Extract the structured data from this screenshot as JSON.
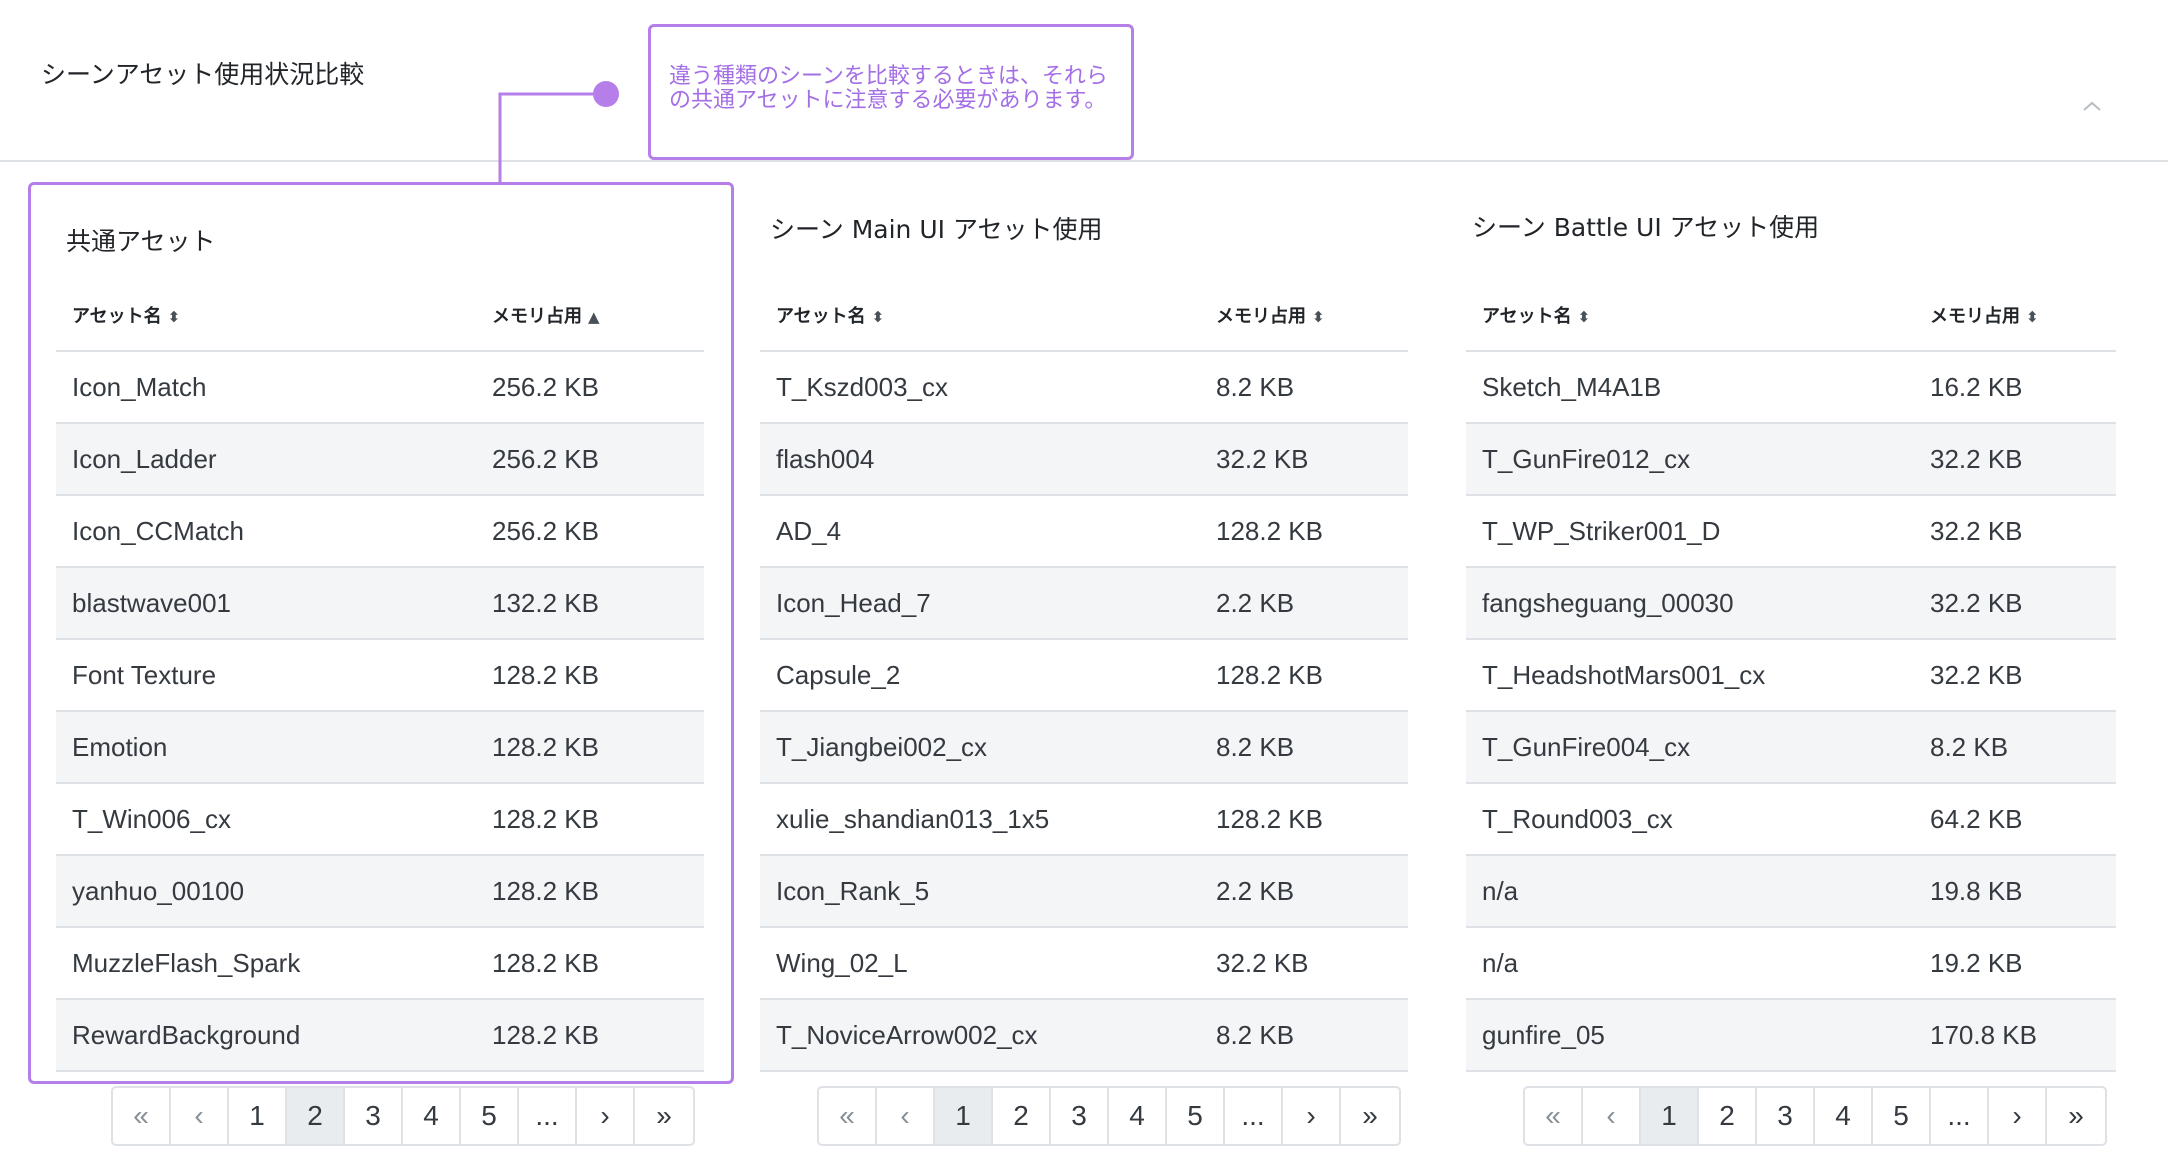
{
  "page_title": "シーンアセット使用状況比較",
  "callout": {
    "text": "違う種類のシーンを比較するときは、それらの共通アセットに注意する必要があります。"
  },
  "colors": {
    "accent": "#b57ee8",
    "stripe": "#f4f5f7",
    "border": "#dee2e6"
  },
  "icons": {
    "collapse": "chevron-up-icon",
    "sort": "sort-icon",
    "sort_asc": "sort-asc-icon"
  },
  "panels": [
    {
      "title": "共通アセット",
      "columns": [
        {
          "label": "アセット名",
          "sort": "both"
        },
        {
          "label": "メモリ占用",
          "sort": "asc"
        }
      ],
      "rows": [
        [
          "Icon_Match",
          "256.2 KB"
        ],
        [
          "Icon_Ladder",
          "256.2 KB"
        ],
        [
          "Icon_CCMatch",
          "256.2 KB"
        ],
        [
          "blastwave001",
          "132.2 KB"
        ],
        [
          "Font Texture",
          "128.2 KB"
        ],
        [
          "Emotion",
          "128.2 KB"
        ],
        [
          "T_Win006_cx",
          "128.2 KB"
        ],
        [
          "yanhuo_00100",
          "128.2 KB"
        ],
        [
          "MuzzleFlash_Spark",
          "128.2 KB"
        ],
        [
          "RewardBackground",
          "128.2 KB"
        ]
      ],
      "pagination": {
        "first": "«",
        "prev": "‹",
        "pages": [
          "1",
          "2",
          "3",
          "4",
          "5"
        ],
        "ellipsis": "...",
        "next": "›",
        "last": "»",
        "active": "2"
      }
    },
    {
      "title": "シーン Main UI アセット使用",
      "columns": [
        {
          "label": "アセット名",
          "sort": "both"
        },
        {
          "label": "メモリ占用",
          "sort": "both"
        }
      ],
      "rows": [
        [
          "T_Kszd003_cx",
          "8.2 KB"
        ],
        [
          "flash004",
          "32.2 KB"
        ],
        [
          "AD_4",
          "128.2 KB"
        ],
        [
          "Icon_Head_7",
          "2.2 KB"
        ],
        [
          "Capsule_2",
          "128.2 KB"
        ],
        [
          "T_Jiangbei002_cx",
          "8.2 KB"
        ],
        [
          "xulie_shandian013_1x5",
          "128.2 KB"
        ],
        [
          "Icon_Rank_5",
          "2.2 KB"
        ],
        [
          "Wing_02_L",
          "32.2 KB"
        ],
        [
          "T_NoviceArrow002_cx",
          "8.2 KB"
        ]
      ],
      "pagination": {
        "first": "«",
        "prev": "‹",
        "pages": [
          "1",
          "2",
          "3",
          "4",
          "5"
        ],
        "ellipsis": "...",
        "next": "›",
        "last": "»",
        "active": "1"
      }
    },
    {
      "title": "シーン Battle UI アセット使用",
      "columns": [
        {
          "label": "アセット名",
          "sort": "both"
        },
        {
          "label": "メモリ占用",
          "sort": "both"
        }
      ],
      "rows": [
        [
          "Sketch_M4A1B",
          "16.2 KB"
        ],
        [
          "T_GunFire012_cx",
          "32.2 KB"
        ],
        [
          "T_WP_Striker001_D",
          "32.2 KB"
        ],
        [
          "fangsheguang_00030",
          "32.2 KB"
        ],
        [
          "T_HeadshotMars001_cx",
          "32.2 KB"
        ],
        [
          "T_GunFire004_cx",
          "8.2 KB"
        ],
        [
          "T_Round003_cx",
          "64.2 KB"
        ],
        [
          "n/a",
          "19.8 KB"
        ],
        [
          "n/a",
          "19.2 KB"
        ],
        [
          "gunfire_05",
          "170.8 KB"
        ]
      ],
      "pagination": {
        "first": "«",
        "prev": "‹",
        "pages": [
          "1",
          "2",
          "3",
          "4",
          "5"
        ],
        "ellipsis": "...",
        "next": "›",
        "last": "»",
        "active": "1"
      }
    }
  ]
}
